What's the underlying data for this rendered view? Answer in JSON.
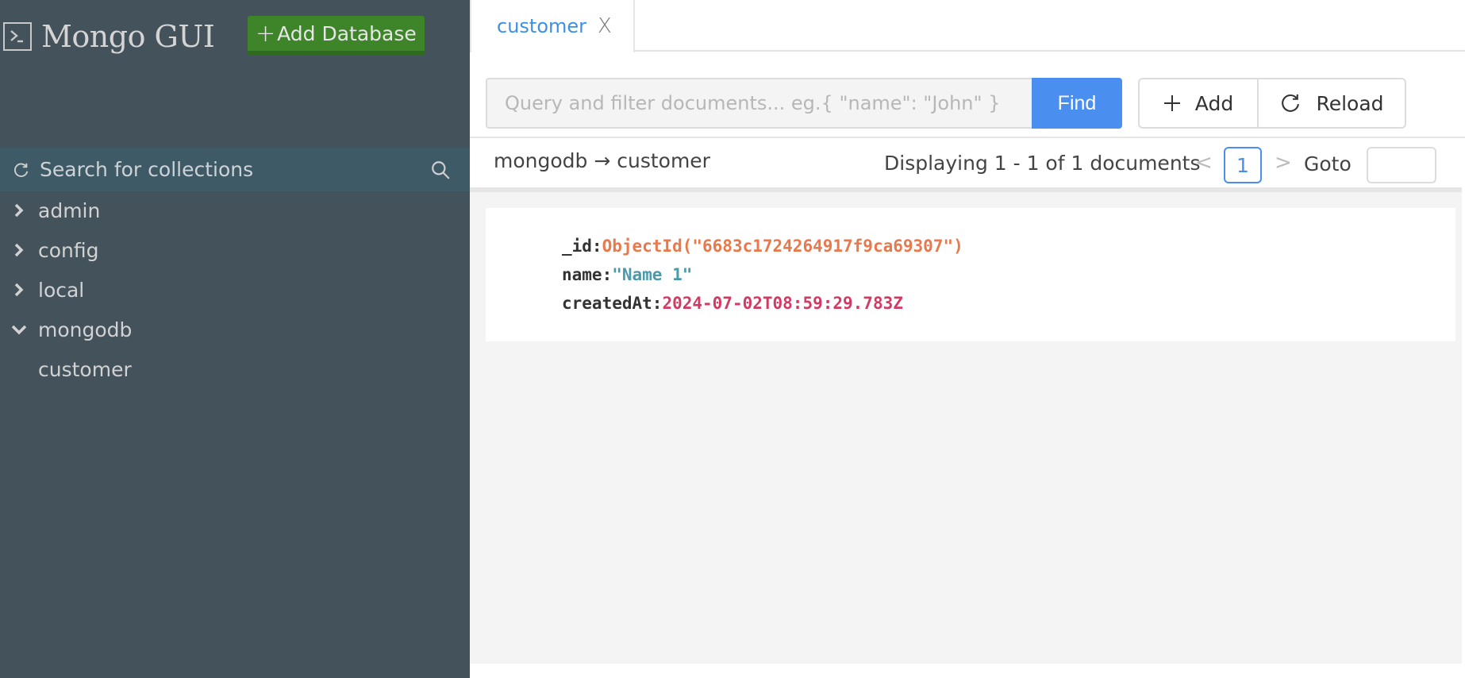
{
  "app": {
    "title": "Mongo GUI",
    "add_database_label": "Add Database",
    "icons": {
      "brand": "terminal-icon",
      "add": "plus-icon"
    }
  },
  "sidebar": {
    "search_placeholder": "Search for collections",
    "databases": [
      {
        "label": "admin",
        "expanded": false
      },
      {
        "label": "config",
        "expanded": false
      },
      {
        "label": "local",
        "expanded": false
      },
      {
        "label": "mongodb",
        "expanded": true,
        "collections": [
          "customer"
        ]
      }
    ]
  },
  "tabs": [
    {
      "label": "customer",
      "active": true,
      "close": "X"
    }
  ],
  "toolbar": {
    "query_placeholder": "Query and filter documents... eg.{ \"name\": \"John\" }",
    "find_label": "Find",
    "add_label": "Add",
    "reload_label": "Reload"
  },
  "info": {
    "breadcrumb": "mongodb → customer",
    "displaying": "Displaying 1 - 1 of 1 documents",
    "current_page": "1",
    "goto_label": "Goto",
    "goto_value": ""
  },
  "documents": [
    {
      "fields": [
        {
          "key": "_id:",
          "value": "ObjectId(\"6683c1724264917f9ca69307\")",
          "type": "objectid"
        },
        {
          "key": "name:",
          "value": "\"Name 1\"",
          "type": "string"
        },
        {
          "key": "createdAt:",
          "value": "2024-07-02T08:59:29.783Z",
          "type": "date"
        }
      ]
    }
  ],
  "colors": {
    "sidebar_bg": "#44525c",
    "accent_blue": "#4a8ef0",
    "add_db_green": "#3e8429",
    "objectid": "#e9784b",
    "string": "#4a9aaa",
    "date": "#d13a63"
  }
}
